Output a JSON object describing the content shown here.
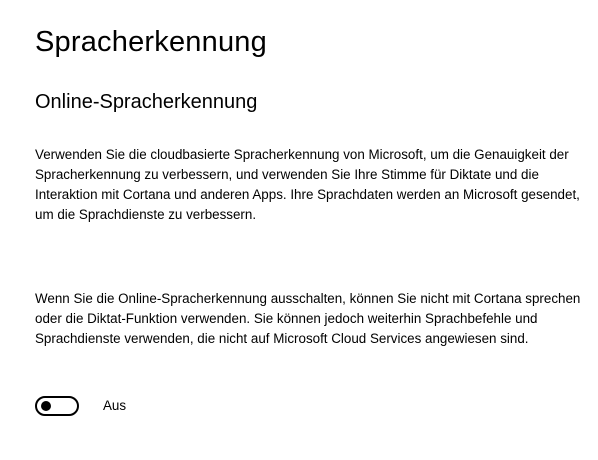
{
  "page": {
    "title": "Spracherkennung"
  },
  "section": {
    "title": "Online-Spracherkennung",
    "paragraph_1": "Verwenden Sie die cloudbasierte Spracherkennung von Microsoft, um die Genauigkeit der Spracherkennung zu verbessern, und verwenden Sie Ihre Stimme für Diktate und die Interaktion mit Cortana und anderen Apps. Ihre Sprachdaten werden an Microsoft gesendet, um die Sprachdienste zu verbessern.",
    "paragraph_2": "Wenn Sie die Online-Spracherkennung ausschalten, können Sie nicht mit Cortana sprechen oder die Diktat-Funktion verwenden. Sie können jedoch weiterhin Sprachbefehle und Sprachdienste verwenden, die nicht auf Microsoft Cloud Services angewiesen sind."
  },
  "toggle": {
    "state_label": "Aus",
    "is_on": false
  }
}
